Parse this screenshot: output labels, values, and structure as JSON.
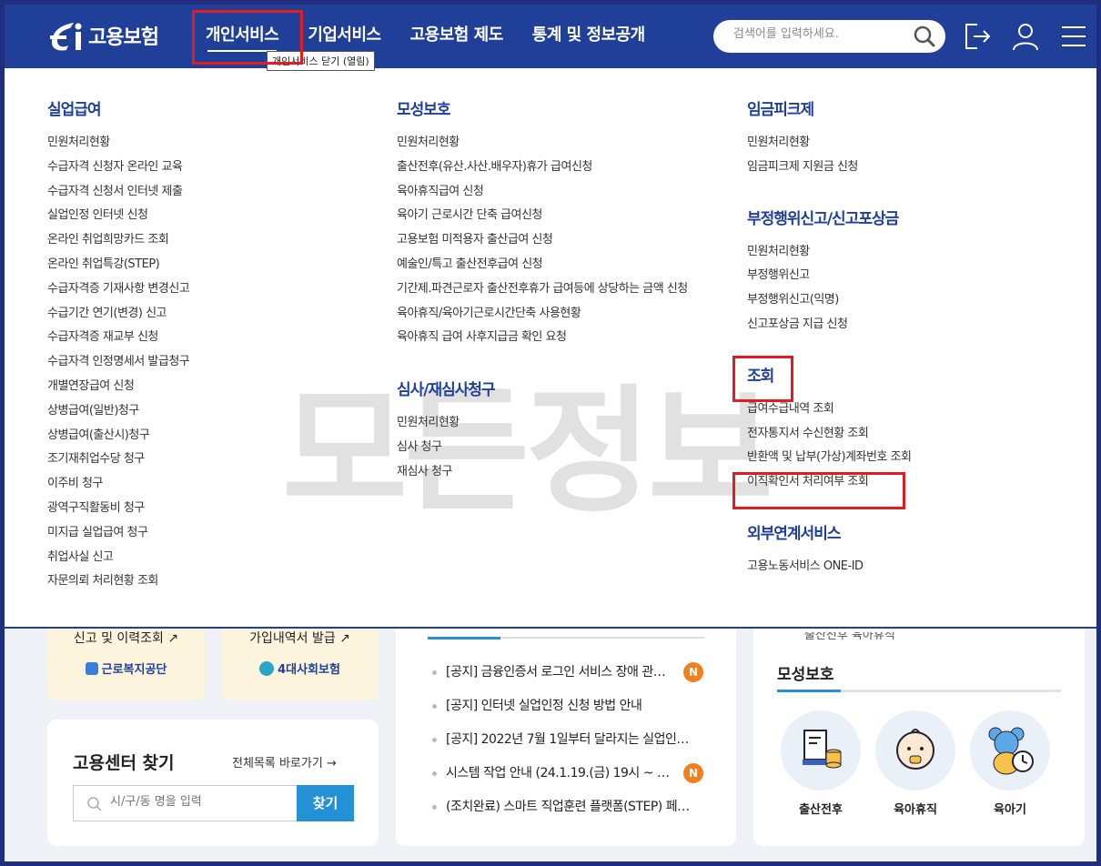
{
  "header": {
    "logo_text": "고용보험",
    "nav": [
      {
        "label": "개인서비스"
      },
      {
        "label": "기업서비스"
      },
      {
        "label": "고용보험 제도"
      },
      {
        "label": "통계 및 정보공개"
      }
    ],
    "tooltip": "개인서비스 닫기 (열림)",
    "search_placeholder": "검색어를 입력하세요."
  },
  "menu": {
    "col1": {
      "groups": [
        {
          "title": "실업급여",
          "items": [
            "민원처리현황",
            "수급자격 신청자 온라인 교육",
            "수급자격 신청서 인터넷 제출",
            "실업인정 인터넷 신청",
            "온라인 취업희망카드 조회",
            "온라인 취업특강(STEP)",
            "수급자격증 기재사항 변경신고",
            "수급기간 연기(변경) 신고",
            "수급자격증 재교부 신청",
            "수급자격 인정명세서 발급청구",
            "개별연장급여 신청",
            "상병급여(일반)청구",
            "상병급여(출산시)청구",
            "조기재취업수당 청구",
            "이주비 청구",
            "광역구직활동비 청구",
            "미지급 실업급여 청구",
            "취업사실 신고",
            "자문의뢰 처리현황 조회"
          ]
        }
      ]
    },
    "col2": {
      "groups": [
        {
          "title": "모성보호",
          "items": [
            "민원처리현황",
            "출산전후(유산.사산.배우자)휴가 급여신청",
            "육아휴직급여 신청",
            "육아기 근로시간 단축 급여신청",
            "고용보험 미적용자 출산급여 신청",
            "예술인/특고 출산전후급여 신청",
            "기간제.파견근로자 출산전후휴가 급여등에 상당하는 금액 신청",
            "육아휴직/육아기근로시간단축 사용현황",
            "육아휴직 급여 사후지급금 확인 요청"
          ]
        },
        {
          "title": "심사/재심사청구",
          "items": [
            "민원처리현황",
            "심사 청구",
            "재심사 청구"
          ]
        }
      ]
    },
    "col3": {
      "groups": [
        {
          "title": "임금피크제",
          "items": [
            "민원처리현황",
            "임금피크제 지원금 신청"
          ]
        },
        {
          "title": "부정행위신고/신고포상금",
          "items": [
            "민원처리현황",
            "부정행위신고",
            "부정행위신고(익명)",
            "신고포상금 지급 신청"
          ]
        },
        {
          "title": "조회",
          "items": [
            "급여수급내역 조회",
            "전자통지서 수신현황 조회",
            "반환액 및 납부(가상)계좌번호 조회",
            "이직확인서 처리여부 조회"
          ]
        },
        {
          "title": "외부연계서비스",
          "items": [
            "고용노동서비스 ONE-ID"
          ]
        }
      ]
    },
    "watermark": "모든정보"
  },
  "below": {
    "quick1": {
      "label": "신고 및 이력조회",
      "org": "근로복지공단"
    },
    "quick2": {
      "label": "가입내역서 발급",
      "org": "4대사회보험"
    },
    "center": {
      "title": "고용센터 찾기",
      "link": "전체목록 바로가기",
      "placeholder": "시/구/동 명을 입력",
      "button": "찾기"
    },
    "news": [
      {
        "text": "[공지] 금융인증서 로그인 서비스 장애 관…",
        "badge": "N"
      },
      {
        "text": "[공지] 인터넷 실업인정 신청 방법 안내",
        "badge": ""
      },
      {
        "text": "[공지] 2022년 7월 1일부터 달라지는 실업인…",
        "badge": ""
      },
      {
        "text": "시스템 작업 안내 (24.1.19.(금) 19시 ~ …",
        "badge": "N"
      },
      {
        "text": "(조치완료) 스마트 직업훈련 플랫폼(STEP) 페…",
        "badge": ""
      }
    ],
    "maternity": {
      "title": "모성보호",
      "partial_text": "출산전후 육아휴직",
      "items": [
        "출산전후",
        "육아휴직",
        "육아기"
      ]
    }
  }
}
